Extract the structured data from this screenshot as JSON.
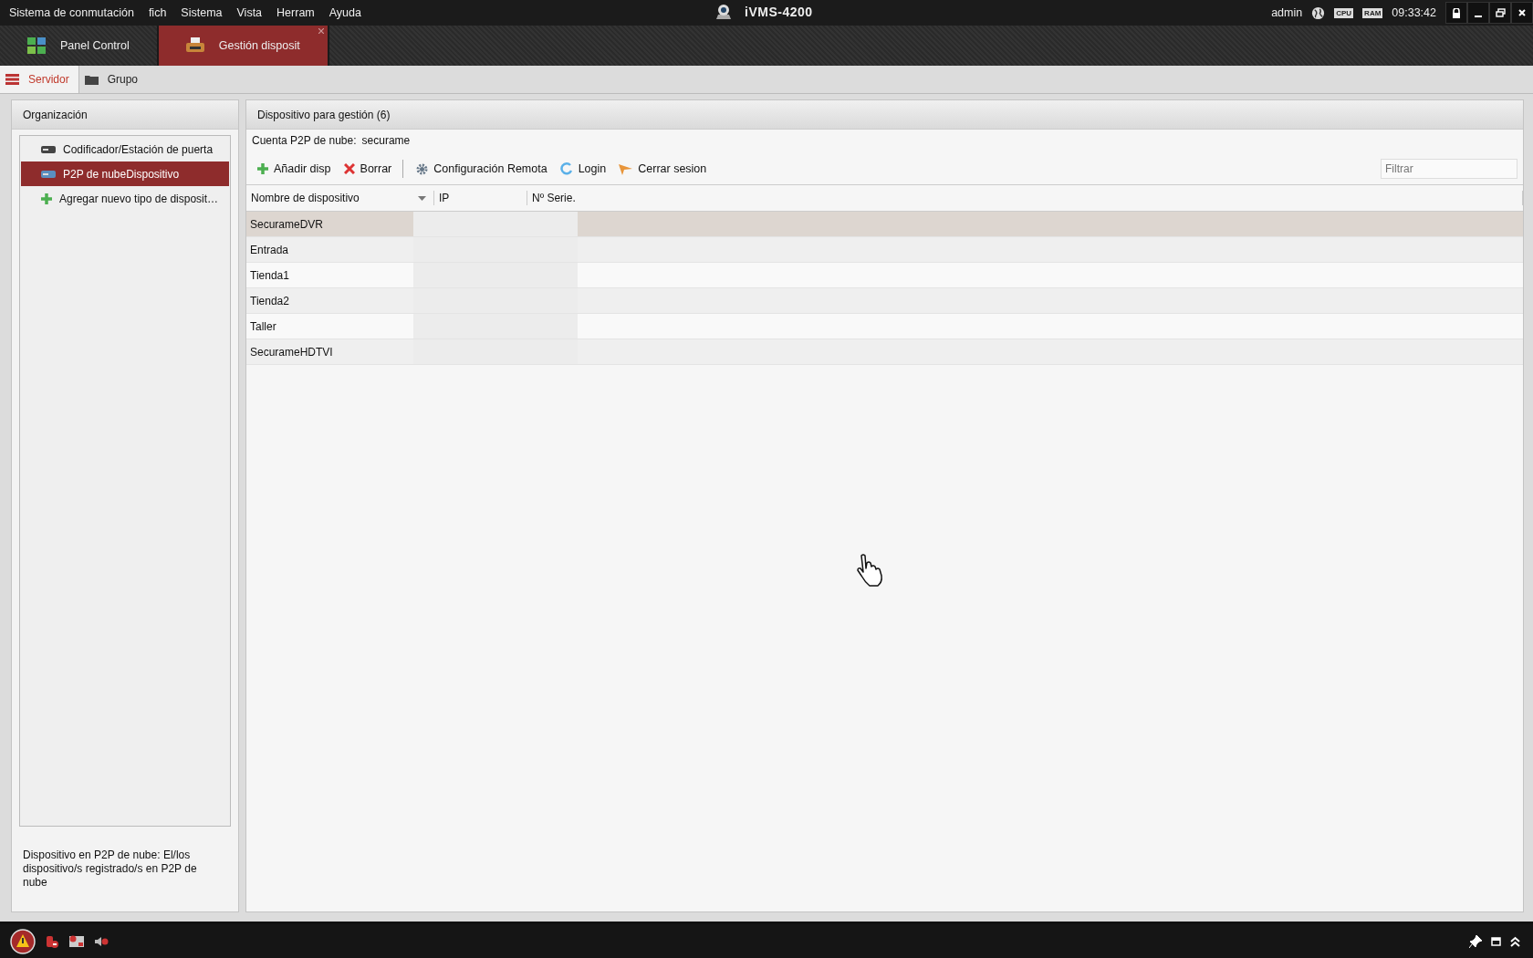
{
  "menu": [
    "Sistema de conmutación",
    "fich",
    "Sistema",
    "Vista",
    "Herram",
    "Ayuda"
  ],
  "app_title": "iVMS-4200",
  "status": {
    "user": "admin",
    "indicators": [
      {
        "label": "CPU"
      },
      {
        "label": "RAM"
      }
    ],
    "time": "09:33:42"
  },
  "main_tabs": [
    {
      "label": "Panel Control",
      "selected": false,
      "kind": "panel"
    },
    {
      "label": "Gestión disposit",
      "selected": true,
      "kind": "devices"
    }
  ],
  "sub_tabs": [
    {
      "label": "Servidor",
      "selected": true,
      "kind": "server"
    },
    {
      "label": "Grupo",
      "selected": false,
      "kind": "group"
    }
  ],
  "sidebar": {
    "title": "Organización",
    "items": [
      {
        "label": "Codificador/Estación de puerta",
        "selected": false,
        "kind": "device"
      },
      {
        "label": "P2P de nubeDispositivo",
        "selected": true,
        "kind": "cloud"
      },
      {
        "label": "Agregar nuevo tipo de disposit…",
        "selected": false,
        "kind": "add"
      }
    ],
    "description": "Dispositivo en P2P de nube: El/los dispositivo/s registrado/s en P2P de nube"
  },
  "panel": {
    "title": "Dispositivo para gestión (6)",
    "account_label": "Cuenta P2P de nube:",
    "account": "securame",
    "toolbar": [
      {
        "label": "Añadir disp",
        "kind": "add"
      },
      {
        "label": "Borrar",
        "kind": "delete"
      },
      {
        "label": "Configuración Remota",
        "kind": "config"
      },
      {
        "label": "Login",
        "kind": "login"
      },
      {
        "label": "Cerrar sesion",
        "kind": "logout"
      }
    ],
    "filter": {
      "placeholder": "Filtrar"
    },
    "table": {
      "columns": [
        "Nombre de dispositivo",
        "IP",
        "Nº Serie."
      ],
      "rows": [
        {
          "name": "SecurameDVR",
          "selected": true
        },
        {
          "name": "Entrada",
          "selected": false
        },
        {
          "name": "Tienda1",
          "selected": false
        },
        {
          "name": "Tienda2",
          "selected": false
        },
        {
          "name": "Taller",
          "selected": false
        },
        {
          "name": "SecurameHDTVI",
          "selected": false
        }
      ]
    }
  }
}
